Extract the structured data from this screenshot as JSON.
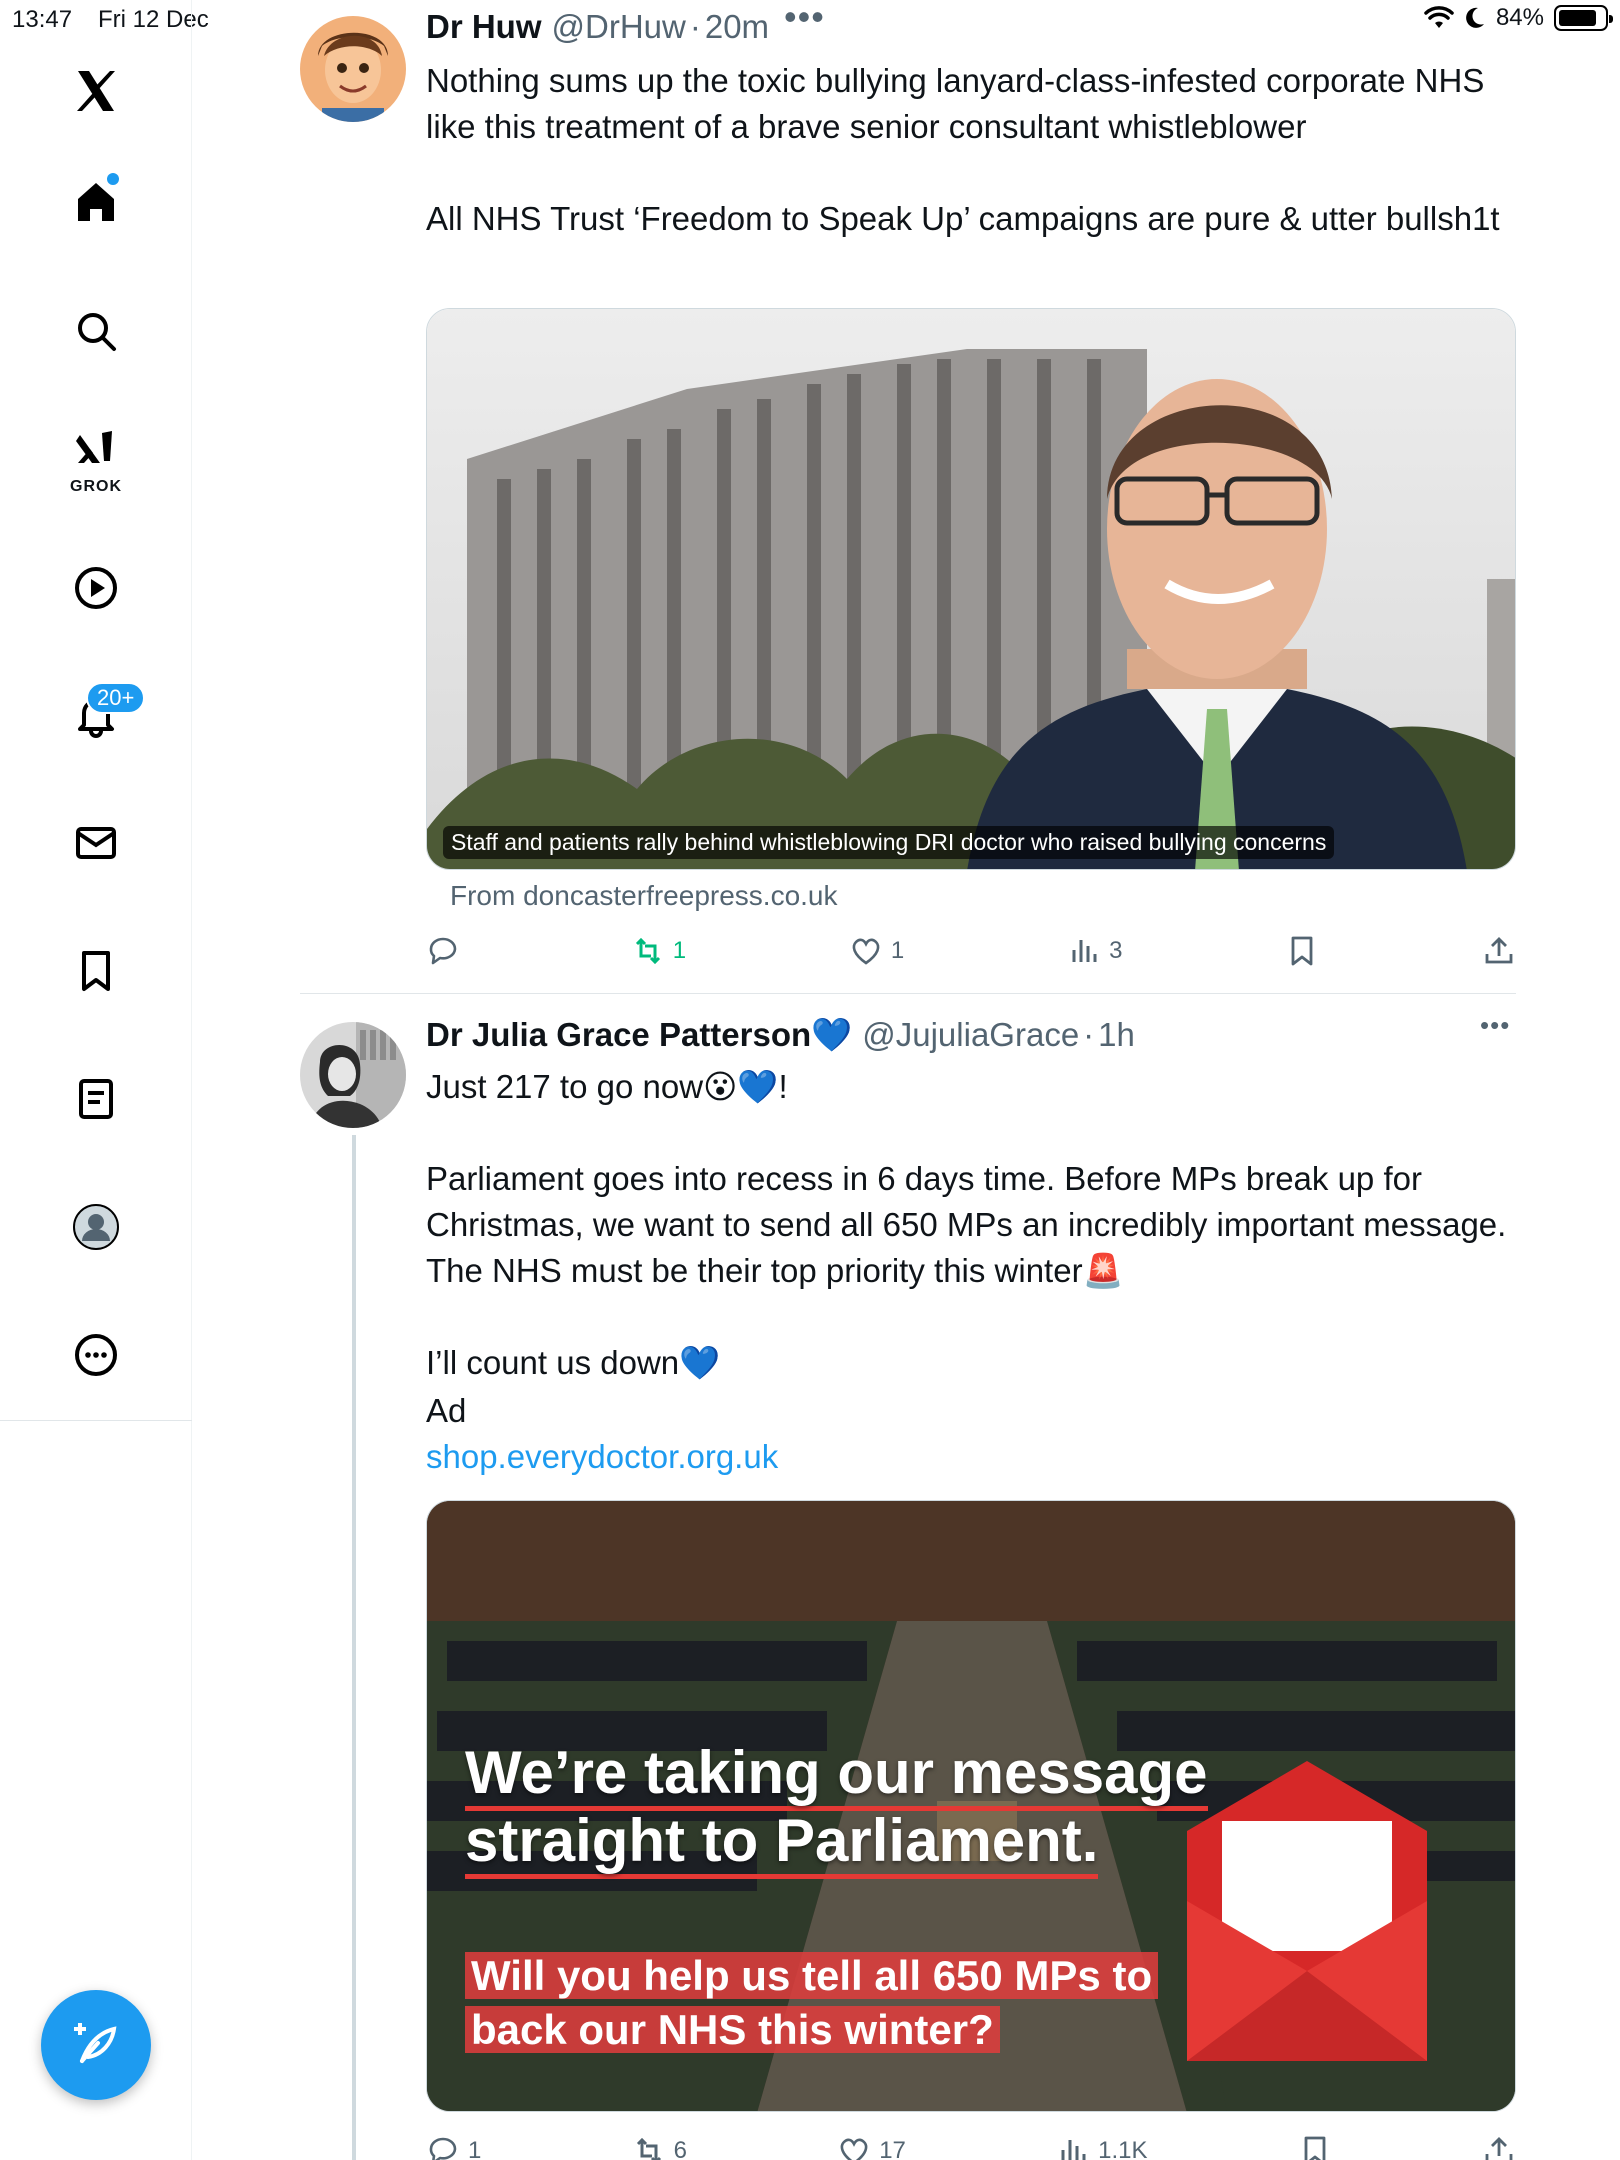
{
  "status_bar": {
    "time": "13:47",
    "date": "Fri 12 Dec",
    "battery": "84%",
    "battery_level": 0.84
  },
  "sidebar": {
    "grok_label": "GROK",
    "notifications_badge": "20+"
  },
  "tweets": [
    {
      "author": "Dr Huw",
      "handle": "@DrHuw",
      "time": "20m",
      "text": "Nothing sums up the toxic bullying lanyard-class-infested corporate NHS like this treatment of a brave senior consultant whistleblower\n\nAll NHS Trust ‘Freedom to Speak Up’ campaigns are pure & utter bullsh1t",
      "card_caption": "Staff and patients rally behind whistleblowing DRI doctor who raised bullying concerns",
      "card_source": "From doncasterfreepress.co.uk",
      "replies": "",
      "reposts": "1",
      "likes": "1",
      "views": "3"
    },
    {
      "author": "Dr Julia Grace Patterson",
      "author_emoji": "💙",
      "handle": "@JujuliaGrace",
      "time": "1h",
      "text": "Just 217 to go now😮💙!\n\nParliament goes into recess in 6 days time. Before MPs break up for Christmas, we want to send all 650 MPs an incredibly important message. The NHS must be their top priority this winter🚨\n\nI’ll count us down💙",
      "ad_label": "Ad",
      "ad_link": "shop.everydoctor.org.uk",
      "image_headline_1": "We’re taking our message",
      "image_headline_2": "straight to Parliament.",
      "image_subline": "Will you help us tell all 650 MPs to back our NHS this winter?",
      "replies": "1",
      "reposts": "6",
      "likes": "17",
      "views": "1.1K"
    }
  ]
}
